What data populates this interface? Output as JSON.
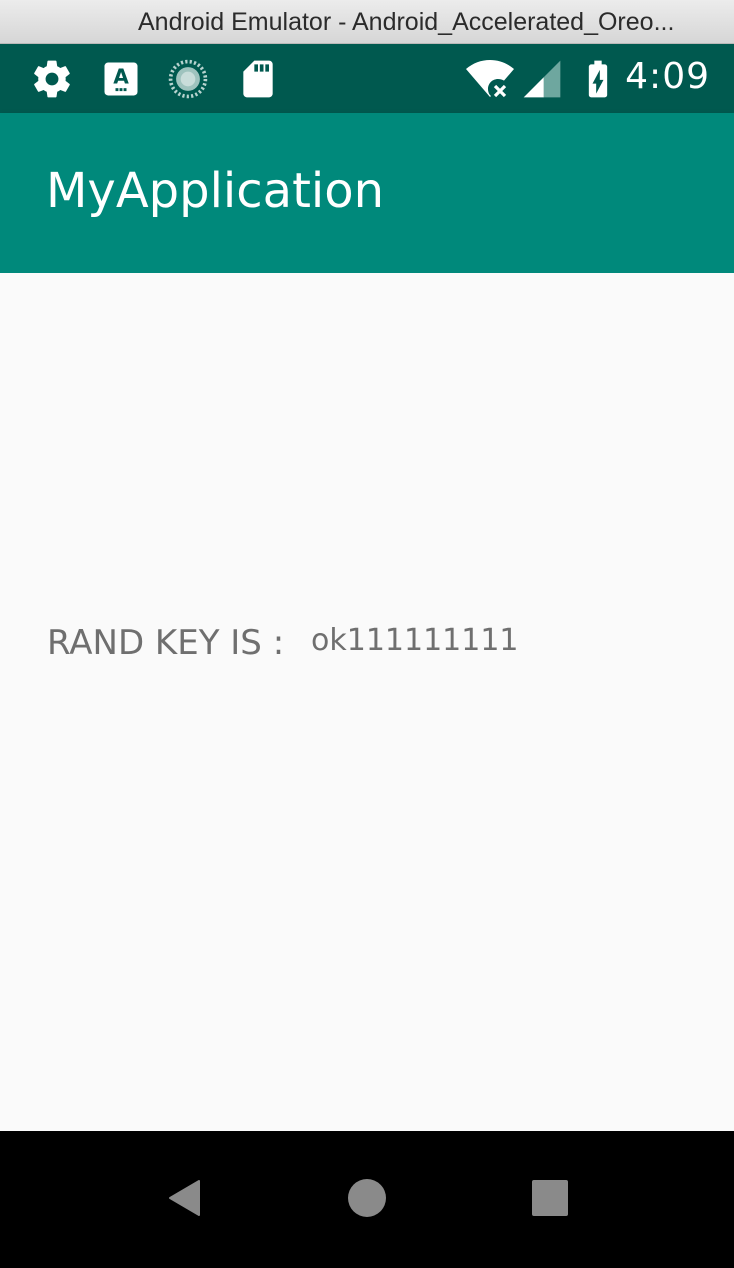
{
  "window": {
    "title": "Android Emulator - Android_Accelerated_Oreo..."
  },
  "status_bar": {
    "left_icons": [
      "gear-icon",
      "keyboard-a-icon",
      "sync-spinner-icon",
      "sd-card-icon"
    ],
    "right_icons": [
      "wifi-off-icon",
      "cell-signal-icon",
      "battery-charging-icon"
    ],
    "time": "4:09"
  },
  "app_bar": {
    "title": "MyApplication"
  },
  "content": {
    "label": "RAND KEY IS :",
    "value": "ok111111111"
  },
  "nav_bar": {
    "buttons": [
      "back-icon",
      "home-icon",
      "recents-icon"
    ]
  },
  "colors": {
    "status_bar": "#00594f",
    "app_bar": "#00897b",
    "background": "#fafafa",
    "text": "#6f6f6f",
    "nav_bar": "#000000"
  }
}
